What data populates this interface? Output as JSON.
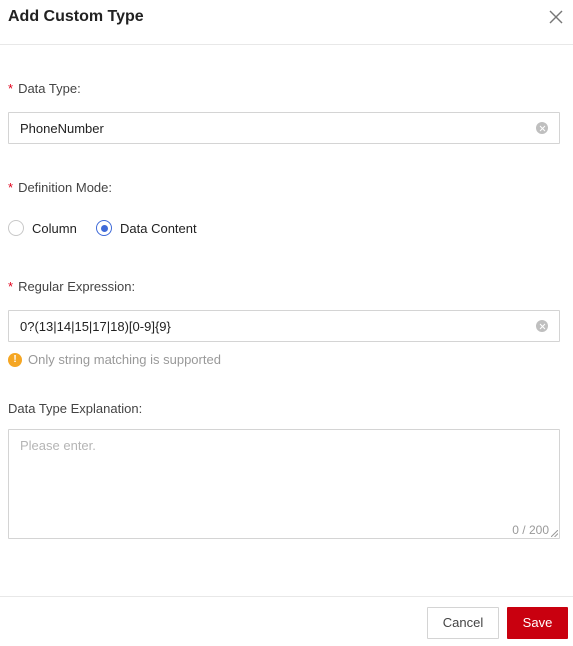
{
  "dialog": {
    "title": "Add Custom Type"
  },
  "form": {
    "required_marker": "*",
    "data_type": {
      "label": "Data Type:",
      "value": "PhoneNumber"
    },
    "definition_mode": {
      "label": "Definition Mode:",
      "options": [
        {
          "label": "Column",
          "selected": false
        },
        {
          "label": "Data Content",
          "selected": true
        }
      ]
    },
    "regular_expression": {
      "label": "Regular Expression:",
      "value": "0?(13|14|15|17|18)[0-9]{9}",
      "hint": "Only string matching is supported",
      "hint_icon": "!"
    },
    "explanation": {
      "label": "Data Type Explanation:",
      "placeholder": "Please enter.",
      "counter": "0 / 200"
    }
  },
  "footer": {
    "cancel_label": "Cancel",
    "save_label": "Save"
  },
  "colors": {
    "accent": "#3f6ad8",
    "required": "#e0001a",
    "primary_button": "#c9000f",
    "warning": "#f5a623"
  }
}
